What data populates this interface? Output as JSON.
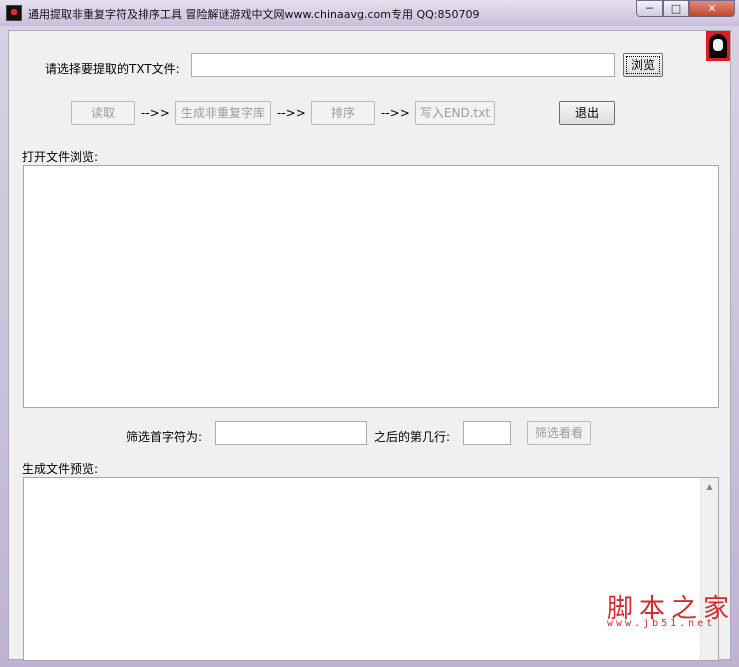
{
  "window": {
    "title": "通用提取非重复字符及排序工具 冒险解谜游戏中文网www.chinaavg.com专用 QQ:850709",
    "controls": {
      "minimize": "─",
      "maximize": "□",
      "close": "✕"
    }
  },
  "file_select": {
    "label": "请选择要提取的TXT文件:",
    "value": "",
    "browse_label": "浏览"
  },
  "pipeline": {
    "read_label": "读取",
    "arrow1": "-->>",
    "generate_label": "生成非重复字库",
    "arrow2": "-->>",
    "sort_label": "排序",
    "arrow3": "-->>",
    "write_label": "写入END.txt",
    "exit_label": "退出"
  },
  "preview_open": {
    "label": "打开文件浏览:",
    "content": ""
  },
  "filter": {
    "first_char_label": "筛选首字符为:",
    "first_char_value": "",
    "after_line_label": "之后的第几行:",
    "after_line_value": "",
    "button_label": "筛选看看"
  },
  "preview_generated": {
    "label": "生成文件预览:",
    "content": "",
    "scroll_up": "▲"
  },
  "watermark": {
    "text": "脚本之家",
    "url": "www.jb51.net"
  },
  "icons": [
    "app-icon",
    "avatar-icon",
    "scroll-up-arrow-icon"
  ]
}
